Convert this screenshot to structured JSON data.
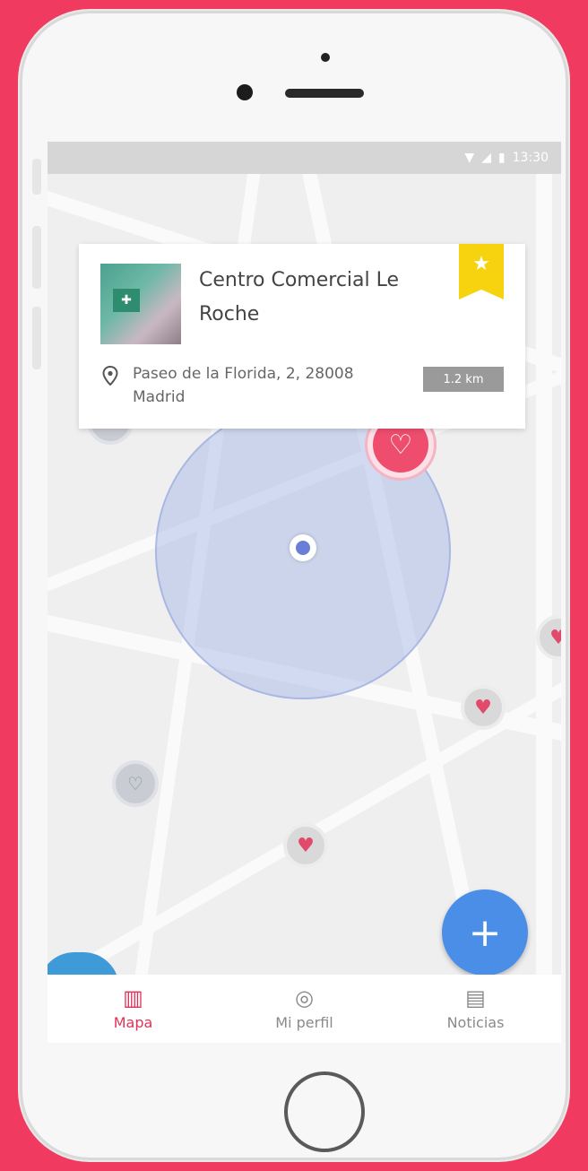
{
  "status_bar": {
    "time": "13:30"
  },
  "place_card": {
    "title": "Centro Comercial Le Roche",
    "address": "Paseo de la Florida, 2, 28008 Madrid",
    "distance": "1.2 km"
  },
  "fab": {
    "label": "+"
  },
  "tabs": [
    {
      "label": "Mapa",
      "icon": "map-icon",
      "active": true
    },
    {
      "label": "Mi perfil",
      "icon": "profile-icon",
      "active": false
    },
    {
      "label": "Noticias",
      "icon": "news-icon",
      "active": false
    }
  ],
  "colors": {
    "brand": "#f03a5f",
    "accent_blue": "#4b8ee8",
    "bookmark": "#f6d20f"
  }
}
